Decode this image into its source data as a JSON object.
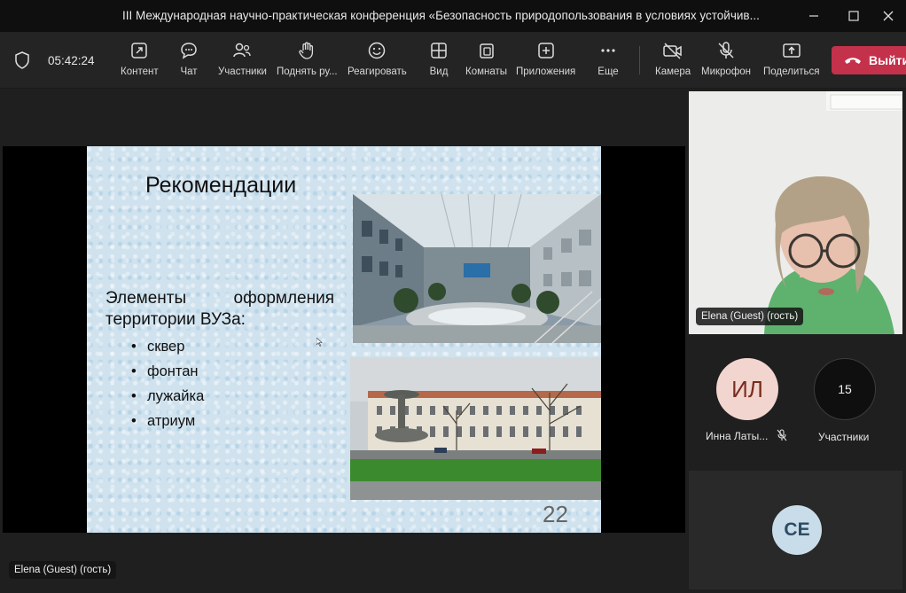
{
  "window": {
    "title": "III Международная научно-практическая конференция «Безопасность природопользования в условиях устойчив...",
    "minimize_icon": "minimize-icon",
    "maximize_icon": "maximize-icon",
    "close_icon": "close-icon"
  },
  "toolbar": {
    "timer": "05:42:24",
    "buttons": [
      {
        "label": "Контент",
        "icon": "share-content-icon"
      },
      {
        "label": "Чат",
        "icon": "chat-icon"
      },
      {
        "label": "Участники",
        "icon": "people-icon"
      },
      {
        "label": "Поднять ру...",
        "icon": "raise-hand-icon"
      },
      {
        "label": "Реагировать",
        "icon": "smile-icon"
      },
      {
        "label": "Вид",
        "icon": "grid-view-icon"
      },
      {
        "label": "Комнаты",
        "icon": "rooms-icon"
      },
      {
        "label": "Приложения",
        "icon": "apps-plus-icon"
      },
      {
        "label": "Еще",
        "icon": "more-icon"
      },
      {
        "label": "Камера",
        "icon": "camera-off-icon"
      },
      {
        "label": "Микрофон",
        "icon": "mic-off-icon"
      },
      {
        "label": "Поделиться",
        "icon": "share-upload-icon"
      }
    ],
    "leave_label": "Выйти",
    "leave_color": "#c4314b"
  },
  "slide": {
    "title": "Рекомендации",
    "lead_line1": "Элементы оформления",
    "lead_line2": "территории ВУЗа:",
    "bullets": [
      "сквер",
      "фонтан",
      "лужайка",
      "атриум"
    ],
    "page_number": "22",
    "background": "#cfe2ee"
  },
  "presenter_tag": "Elena (Guest) (гость)",
  "video_tile": {
    "name": "Elena (Guest) (гость)"
  },
  "participants": {
    "person": {
      "initials": "ИЛ",
      "name": "Инна Латы...",
      "muted_icon": "mic-off-icon",
      "avatar_color": "#f2d5cf",
      "initials_color": "#7a2d1e"
    },
    "count_tile": {
      "count": "15",
      "label": "Участники"
    },
    "bottom_tile": {
      "initials": "CE",
      "avatar_color": "#c9dcea",
      "initials_color": "#2d4c63"
    }
  }
}
